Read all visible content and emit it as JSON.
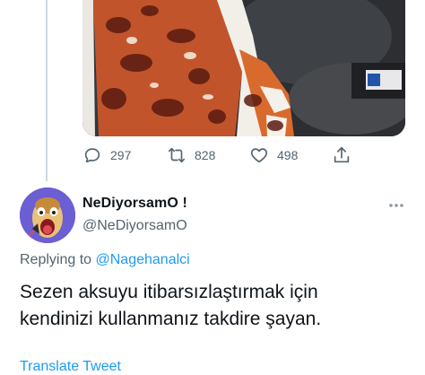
{
  "parent_tweet": {
    "media_description_icon": "photo",
    "stats": {
      "replies": "297",
      "retweets": "828",
      "likes": "498"
    }
  },
  "reply": {
    "display_name": "NeDiyorsamO !",
    "handle": "@NeDiyorsamO",
    "replying_prefix": "Replying to ",
    "replying_to": "@Nagehanalci",
    "text_lines": [
      "Sezen aksuyu itibarsızlaştırmak için",
      "kendinizi kullanmanız takdire şayan."
    ],
    "translate_label": "Translate Tweet"
  },
  "colors": {
    "accent": "#1d9bf0",
    "secondary_text": "#536471",
    "primary_text": "#0f1419",
    "thread_line": "#cfd9de"
  },
  "icons": {
    "reply": "comment-icon",
    "retweet": "retweet-icon",
    "like": "heart-icon",
    "share": "share-icon",
    "more": "more-icon"
  }
}
